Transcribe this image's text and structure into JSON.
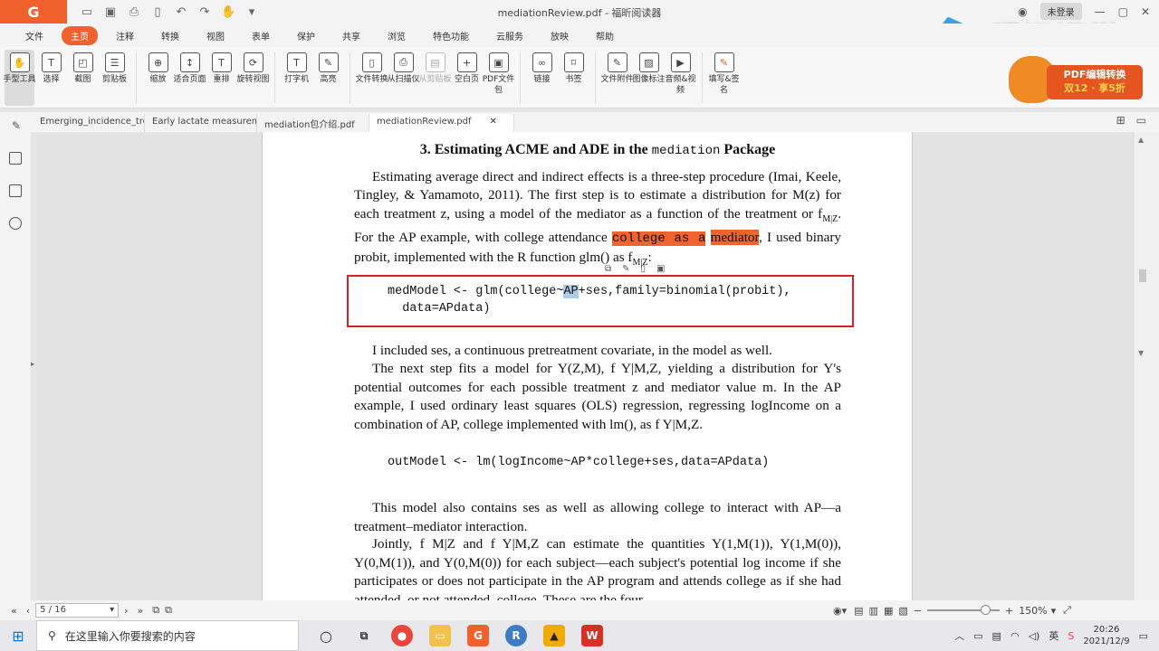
{
  "app": {
    "logo": "G",
    "title": "mediationReview.pdf - 福昕阅读器",
    "login_label": "未登录"
  },
  "menu": [
    "文件",
    "主页",
    "注释",
    "转换",
    "视图",
    "表单",
    "保护",
    "共享",
    "浏览",
    "特色功能",
    "云服务",
    "放映",
    "帮助"
  ],
  "ribbon": [
    {
      "label": "手型工具",
      "icon": "hand-icon"
    },
    {
      "label": "选择",
      "icon": "select-icon"
    },
    {
      "label": "截图",
      "icon": "screenshot-icon"
    },
    {
      "label": "剪贴板",
      "icon": "clipboard-icon"
    },
    {
      "label": "缩放",
      "icon": "zoom-icon"
    },
    {
      "label": "适合页面",
      "icon": "fit-page-icon"
    },
    {
      "label": "重排",
      "icon": "reflow-icon"
    },
    {
      "label": "旋转视图",
      "icon": "rotate-icon"
    },
    {
      "label": "打字机",
      "icon": "typewriter-icon"
    },
    {
      "label": "高亮",
      "icon": "highlight-icon"
    },
    {
      "label": "文件转换",
      "icon": "convert-icon"
    },
    {
      "label": "从扫描仪",
      "icon": "scanner-icon"
    },
    {
      "label": "从剪贴板",
      "icon": "from-clipboard-icon"
    },
    {
      "label": "空白页",
      "icon": "blank-page-icon"
    },
    {
      "label": "PDF文件包",
      "icon": "pdf-package-icon"
    },
    {
      "label": "链接",
      "icon": "link-icon"
    },
    {
      "label": "书签",
      "icon": "bookmark-icon"
    },
    {
      "label": "文件附件",
      "icon": "attachment-icon"
    },
    {
      "label": "图像标注",
      "icon": "image-annot-icon"
    },
    {
      "label": "音频&视频",
      "icon": "media-icon"
    },
    {
      "label": "填写&签名",
      "icon": "sign-icon"
    }
  ],
  "brand": {
    "text": "腾讯课堂",
    "promo_line1": "PDF编辑转换",
    "promo_line2": "双12 · 享5折"
  },
  "doctabs": [
    "Emerging_incidence_tre...",
    "Early lactate measurem...",
    "mediation包介绍.pdf",
    "mediationReview.pdf"
  ],
  "doc": {
    "heading_pre": "3. Estimating ACME and ADE in the ",
    "heading_code": "mediation",
    "heading_post": " Package",
    "p1": "Estimating average direct and indirect effects is a three-step procedure (Imai, Keele, Tingley, & Yamamoto, 2011). The first step is to estimate a distribution for M(z) for each treatment z, using a model of the mediator as a function of the treatment or f",
    "p1_sub": "M|Z",
    "p1_b": ". For the AP example, with college attendance ",
    "p1_hl1": "college as a",
    "p1_hl2": "mediator",
    "p1_c": ", I used binary probit, implemented with the R function glm() as f",
    "p1_sub2": "M|Z",
    "p1_end": ":",
    "code1_a": "medModel <- glm(college~",
    "code1_sel": "AP",
    "code1_b": "+ses,family=binomial(probit),",
    "code1_line2": "  data=APdata)",
    "p2": "I included ses, a continuous pretreatment covariate, in the model as well.",
    "p3": "The next step fits a model for Y(Z,M), f Y|M,Z, yielding a distribution for Y's potential outcomes for each possible treatment z and mediator value m. In the AP example, I used ordinary least squares (OLS) regression, regressing logIncome on a combination of AP, college implemented with lm(), as f Y|M,Z.",
    "code2": "outModel <- lm(logIncome~AP*college+ses,data=APdata)",
    "p4": "This model also contains ses as well as allowing college to interact with AP—a treatment–mediator interaction.",
    "p5": "Jointly, f M|Z and f Y|M,Z can estimate the quantities Y(1,M(1)), Y(1,M(0)), Y(0,M(1)), and Y(0,M(0)) for each subject—each subject's potential log income if she participates or does not participate in the AP program and attends college as if she had attended, or not attended, college. These are the four"
  },
  "status": {
    "page": "5 / 16",
    "zoom": "150%",
    "zoom_level": 0.8
  },
  "taskbar": {
    "search_placeholder": "在这里输入你要搜索的内容",
    "time": "20:26",
    "date": "2021/12/9"
  }
}
